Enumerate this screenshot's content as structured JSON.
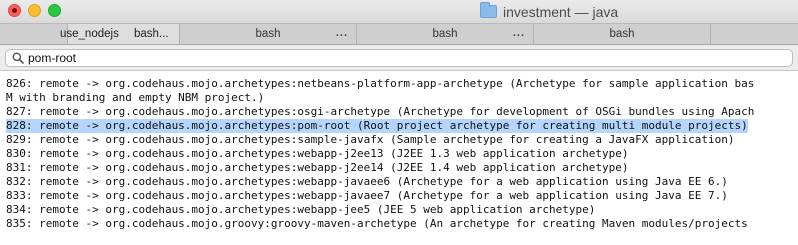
{
  "window": {
    "title": "investment — java",
    "folder_icon": "folder-icon"
  },
  "tabs": [
    {
      "label": "use_nodejs"
    },
    {
      "label": "bash",
      "label2": "bash..."
    },
    {
      "label": "bash"
    },
    {
      "label": "bash"
    },
    {
      "label": "bash"
    },
    {
      "label": ""
    }
  ],
  "tab_dots": "...",
  "search": {
    "value": "pom-root"
  },
  "terminal": {
    "lines": [
      "826: remote -> org.codehaus.mojo.archetypes:netbeans-platform-app-archetype (Archetype for sample application bas",
      "M with branding and empty NBM project.)",
      "827: remote -> org.codehaus.mojo.archetypes:osgi-archetype (Archetype for development of OSGi bundles using Apach",
      "828: remote -> org.codehaus.mojo.archetypes:pom-root (Root project archetype for creating multi module projects)",
      "829: remote -> org.codehaus.mojo.archetypes:sample-javafx (Sample archetype for creating a JavaFX application)",
      "830: remote -> org.codehaus.mojo.archetypes:webapp-j2ee13 (J2EE 1.3 web application archetype)",
      "831: remote -> org.codehaus.mojo.archetypes:webapp-j2ee14 (J2EE 1.4 web application archetype)",
      "832: remote -> org.codehaus.mojo.archetypes:webapp-javaee6 (Archetype for a web application using Java EE 6.)",
      "833: remote -> org.codehaus.mojo.archetypes:webapp-javaee7 (Archetype for a web application using Java EE 7.)",
      "834: remote -> org.codehaus.mojo.archetypes:webapp-jee5 (JEE 5 web application archetype)",
      "835: remote -> org.codehaus.mojo.groovy:groovy-maven-archetype (An archetype for creating Maven modules/projects"
    ],
    "highlight_color": "#b5d5fd"
  }
}
